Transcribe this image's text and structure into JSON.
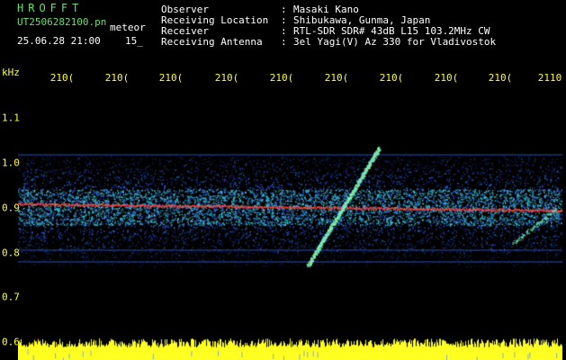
{
  "header": {
    "logo": "HROFFT",
    "file_name": "UT2506282100.pn",
    "file_suffix": "meteor",
    "date_time": "25.06.28 21:00",
    "count": "15_",
    "observer_label": "Observer",
    "location_label": "Receiving Location",
    "receiver_label": "Receiver",
    "antenna_label": "Receiving Antenna",
    "separator": ":",
    "observer": "Masaki Kano",
    "location": "Shibukawa, Gunma, Japan",
    "receiver": "RTL-SDR SDR# 43dB L15 103.2MHz CW",
    "antenna": "3el Yagi(V) Az 330 for Vladivostok"
  },
  "axis": {
    "unit": "kHz",
    "time_ticks": [
      "210(",
      "210(",
      "210(",
      "210(",
      "210(",
      "210(",
      "210(",
      "210(",
      "210(",
      "2110"
    ],
    "freq_ticks": [
      "1.1",
      "1.0",
      "0.9",
      "0.8",
      "0.7",
      "0.6"
    ]
  },
  "colors": {
    "background": "#000000",
    "header_green": "#6fdc6f",
    "axis_yellow": "#ffff33",
    "carrier_red": "#ff3030",
    "noise_blue": "#1e3cc8",
    "meteor_cyan": "#50f0ff"
  }
}
